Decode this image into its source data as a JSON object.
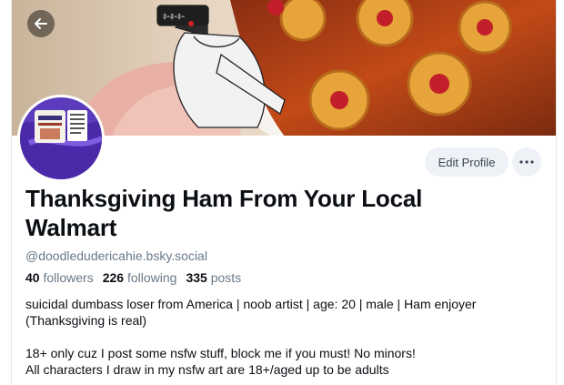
{
  "header": {
    "back_icon": "arrow-left-icon"
  },
  "profile": {
    "display_name": "Thanksgiving Ham From Your Local Walmart",
    "handle": "@doodledudericahie.bsky.social",
    "followers_count": "40",
    "followers_label": "followers",
    "following_count": "226",
    "following_label": "following",
    "posts_count": "335",
    "posts_label": "posts",
    "bio_line1": "suicidal dumbass loser from America | noob artist | age: 20 | male | Ham enjoyer",
    "bio_line2": "(Thanksgiving is real)",
    "bio_line3": "18+ only cuz I post some nsfw stuff, block me if you must! No minors!",
    "bio_line4": "All characters I draw in my nsfw art are 18+/aged up to be adults"
  },
  "actions": {
    "edit_profile_label": "Edit Profile",
    "more_icon": "ellipsis-icon"
  },
  "colors": {
    "accent_text": "#0b0f14",
    "muted_text": "#6a7886",
    "button_bg": "#eef2f6"
  }
}
